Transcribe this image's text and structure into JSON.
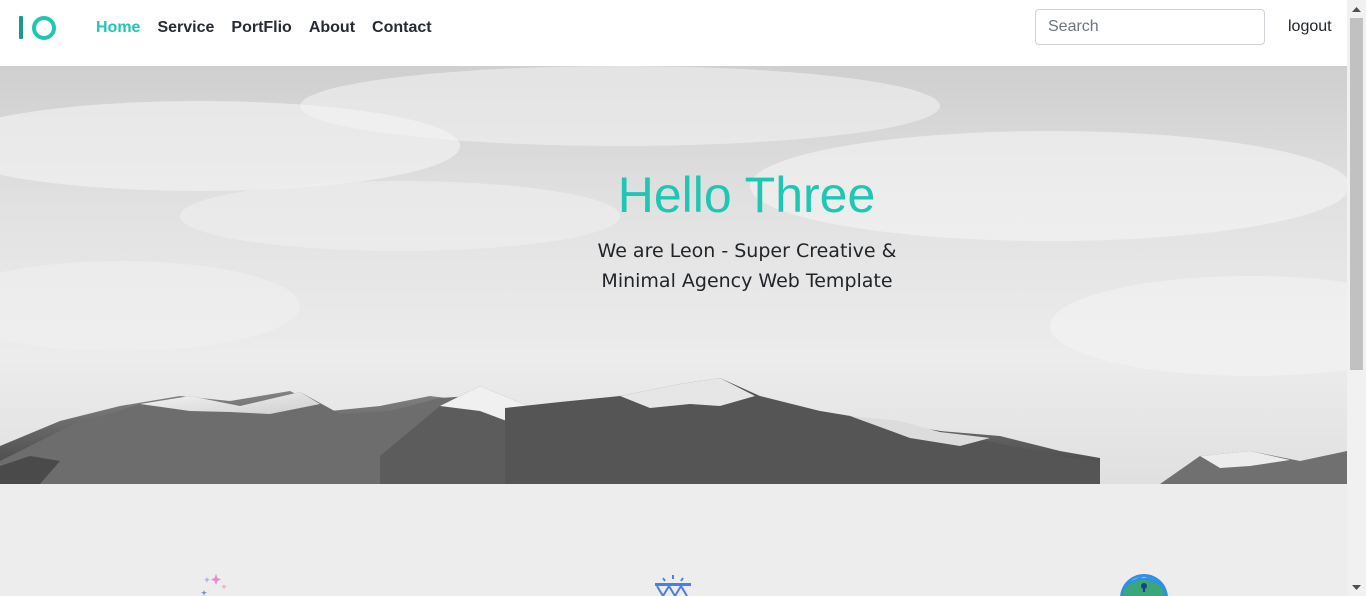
{
  "colors": {
    "accent": "#1ec7b3",
    "logo": "#1a9a8e",
    "nav_text": "#272c33",
    "feature_bg": "#ededed"
  },
  "header": {
    "nav": [
      {
        "label": "Home",
        "active": true
      },
      {
        "label": "Service",
        "active": false
      },
      {
        "label": "PortFlio",
        "active": false
      },
      {
        "label": "About",
        "active": false
      },
      {
        "label": "Contact",
        "active": false
      }
    ],
    "search": {
      "placeholder": "Search",
      "value": ""
    },
    "logout_label": "logout"
  },
  "hero": {
    "title": "Hello Three",
    "subtitle_line1": "We are Leon - Super Creative &",
    "subtitle_line2": "Minimal Agency Web Template",
    "background": "snowy-mountain-range-photo"
  },
  "features": {
    "icons": [
      "sparkles-icon",
      "bridge-icon",
      "globe-icon"
    ]
  }
}
